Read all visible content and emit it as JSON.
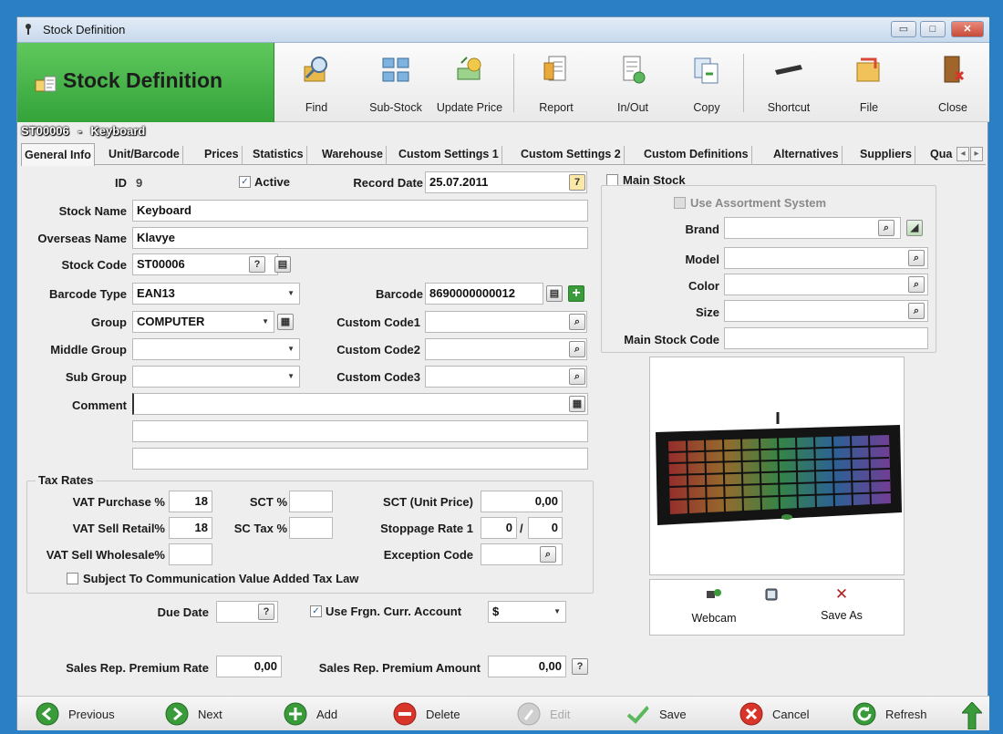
{
  "window": {
    "title": "Stock Definition",
    "minimize": "▭",
    "maximize": "□",
    "close": "✕"
  },
  "banner": {
    "title": "Stock Definition"
  },
  "toolbar": {
    "find": "Find",
    "sub_stock": "Sub-Stock",
    "update_price": "Update Price",
    "report": "Report",
    "in_out": "In/Out",
    "copy": "Copy",
    "shortcut": "Shortcut",
    "file": "File",
    "close": "Close"
  },
  "record": {
    "code": "ST00006",
    "separator": "-",
    "name": "Keyboard"
  },
  "tabs": [
    "General Info",
    "Unit/Barcode",
    "Prices",
    "Statistics",
    "Warehouse",
    "Custom Settings 1",
    "Custom Settings 2",
    "Custom Definitions",
    "Alternatives",
    "Suppliers",
    "Qua"
  ],
  "form": {
    "id_label": "ID",
    "id_value": "9",
    "active_label": "Active",
    "active_checked": true,
    "record_date_label": "Record Date",
    "record_date": "25.07.2011",
    "stock_name_label": "Stock Name",
    "stock_name": "Keyboard",
    "overseas_name_label": "Overseas Name",
    "overseas_name": "Klavye",
    "stock_code_label": "Stock Code",
    "stock_code": "ST00006",
    "barcode_type_label": "Barcode Type",
    "barcode_type": "EAN13",
    "barcode_label": "Barcode",
    "barcode": "8690000000012",
    "group_label": "Group",
    "group": "COMPUTER",
    "middle_group_label": "Middle Group",
    "middle_group": "",
    "sub_group_label": "Sub Group",
    "sub_group": "",
    "custom_code1_label": "Custom Code1",
    "custom_code1": "",
    "custom_code2_label": "Custom Code2",
    "custom_code2": "",
    "custom_code3_label": "Custom Code3",
    "custom_code3": "",
    "comment_label": "Comment",
    "comment": ""
  },
  "tax": {
    "legend": "Tax Rates",
    "vat_purchase_label": "VAT Purchase %",
    "vat_purchase": "18",
    "vat_sell_retail_label": "VAT Sell Retail%",
    "vat_sell_retail": "18",
    "vat_sell_wholesale_label": "VAT Sell Wholesale%",
    "vat_sell_wholesale": "",
    "sct_label": "SCT %",
    "sct": "",
    "sc_tax_label": "SC Tax %",
    "sc_tax": "",
    "sct_unit_label": "SCT (Unit Price)",
    "sct_unit": "0,00",
    "stoppage_label": "Stoppage Rate 1",
    "stoppage_a": "0",
    "stoppage_sep": "/",
    "stoppage_b": "0",
    "exception_label": "Exception Code",
    "exception": "",
    "comm_tax_label": "Subject To Communication Value Added Tax Law",
    "comm_tax_checked": false
  },
  "misc": {
    "due_date_label": "Due Date",
    "due_date": "",
    "frgn_label": "Use Frgn. Curr. Account",
    "frgn_checked": true,
    "currency": "$",
    "premium_rate_label": "Sales Rep. Premium Rate",
    "premium_rate": "0,00",
    "premium_amount_label": "Sales Rep. Premium Amount",
    "premium_amount": "0,00"
  },
  "right": {
    "main_stock_label": "Main Stock",
    "main_stock_checked": false,
    "assortment_label": "Use Assortment System",
    "brand_label": "Brand",
    "brand": "",
    "model_label": "Model",
    "model": "",
    "color_label": "Color",
    "color": "",
    "size_label": "Size",
    "size": "",
    "main_stock_code_label": "Main Stock Code",
    "main_stock_code": ""
  },
  "image_panel": {
    "webcam": "Webcam",
    "save_as": "Save As"
  },
  "bottom": {
    "previous": "Previous",
    "next": "Next",
    "add": "Add",
    "delete": "Delete",
    "edit": "Edit",
    "save": "Save",
    "cancel": "Cancel",
    "refresh": "Refresh"
  },
  "colors": {
    "banner_green": "#3fae3f",
    "window_border": "#2a7fc5",
    "nav_green": "#3a9b3a",
    "delete_red": "#d9362b"
  }
}
